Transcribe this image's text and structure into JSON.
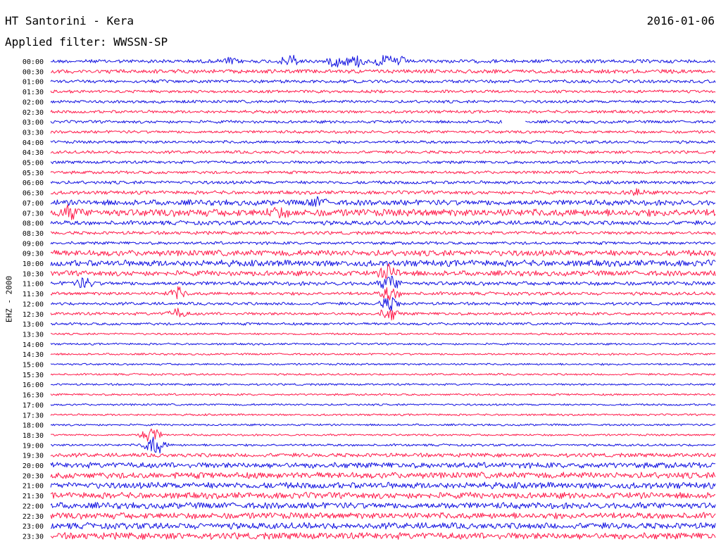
{
  "header": {
    "station": "HT Santorini - Kera",
    "date": "2016-01-06",
    "filter": "Applied filter: WWSSN-SP"
  },
  "channel_label": "EHZ - 2000",
  "colors": {
    "trace_a": "#1010e0",
    "trace_b": "#ff1a4a",
    "background": "#ffffff",
    "text": "#000000"
  },
  "chart_data": {
    "type": "line",
    "description_units": "helicorder: one trace per 30-minute window, amplitude in relative counts",
    "row_labels": [
      "00:00",
      "00:30",
      "01:00",
      "01:30",
      "02:00",
      "02:30",
      "03:00",
      "03:30",
      "04:00",
      "04:30",
      "05:00",
      "05:30",
      "06:00",
      "06:30",
      "07:00",
      "07:30",
      "08:00",
      "08:30",
      "09:00",
      "09:30",
      "10:00",
      "10:30",
      "11:00",
      "11:30",
      "12:00",
      "12:30",
      "13:00",
      "13:30",
      "14:00",
      "14:30",
      "15:00",
      "15:30",
      "16:00",
      "16:30",
      "17:00",
      "17:30",
      "18:00",
      "18:30",
      "19:00",
      "19:30",
      "20:00",
      "20:30",
      "21:00",
      "21:30",
      "22:00",
      "22:30",
      "23:00",
      "23:30"
    ],
    "series_colors": [
      "#1010e0",
      "#ff1a4a"
    ],
    "noise_level": [
      0.55,
      0.6,
      0.5,
      0.45,
      0.45,
      0.45,
      0.45,
      0.45,
      0.45,
      0.45,
      0.45,
      0.45,
      0.5,
      0.55,
      0.85,
      1.1,
      0.65,
      0.5,
      0.45,
      0.9,
      0.95,
      0.8,
      0.6,
      0.5,
      0.45,
      0.45,
      0.4,
      0.3,
      0.3,
      0.3,
      0.3,
      0.3,
      0.3,
      0.3,
      0.3,
      0.3,
      0.3,
      0.3,
      0.35,
      0.6,
      0.85,
      0.95,
      0.95,
      0.95,
      0.95,
      0.95,
      0.95,
      1.0
    ],
    "events": [
      {
        "row": 0,
        "t": 0.36,
        "amp": 2.2
      },
      {
        "row": 0,
        "t": 0.43,
        "amp": 1.6
      },
      {
        "row": 0,
        "t": 0.46,
        "amp": 1.8
      },
      {
        "row": 0,
        "t": 0.5,
        "amp": 1.5
      },
      {
        "row": 0,
        "t": 0.52,
        "amp": 1.7
      },
      {
        "row": 0,
        "t": 0.27,
        "amp": 1.0
      },
      {
        "row": 6,
        "t": 0.69,
        "amp": 1.2
      },
      {
        "row": 13,
        "t": 0.88,
        "amp": 1.0
      },
      {
        "row": 14,
        "t": 0.4,
        "amp": 1.2
      },
      {
        "row": 15,
        "t": 0.03,
        "amp": 1.6
      },
      {
        "row": 15,
        "t": 0.34,
        "amp": 1.3
      },
      {
        "row": 21,
        "t": 0.51,
        "amp": 2.5
      },
      {
        "row": 22,
        "t": 0.05,
        "amp": 1.5
      },
      {
        "row": 22,
        "t": 0.51,
        "amp": 2.5
      },
      {
        "row": 23,
        "t": 0.51,
        "amp": 2.2
      },
      {
        "row": 23,
        "t": 0.19,
        "amp": 1.8
      },
      {
        "row": 24,
        "t": 0.51,
        "amp": 2.2
      },
      {
        "row": 25,
        "t": 0.19,
        "amp": 1.5
      },
      {
        "row": 25,
        "t": 0.51,
        "amp": 2.0
      },
      {
        "row": 37,
        "t": 0.15,
        "amp": 3.0
      },
      {
        "row": 38,
        "t": 0.16,
        "amp": 2.2
      },
      {
        "row": 38,
        "t": 0.15,
        "amp": 1.6
      }
    ],
    "gaps": [
      {
        "row": 6,
        "t_start": 0.679,
        "t_end": 0.713
      }
    ]
  }
}
